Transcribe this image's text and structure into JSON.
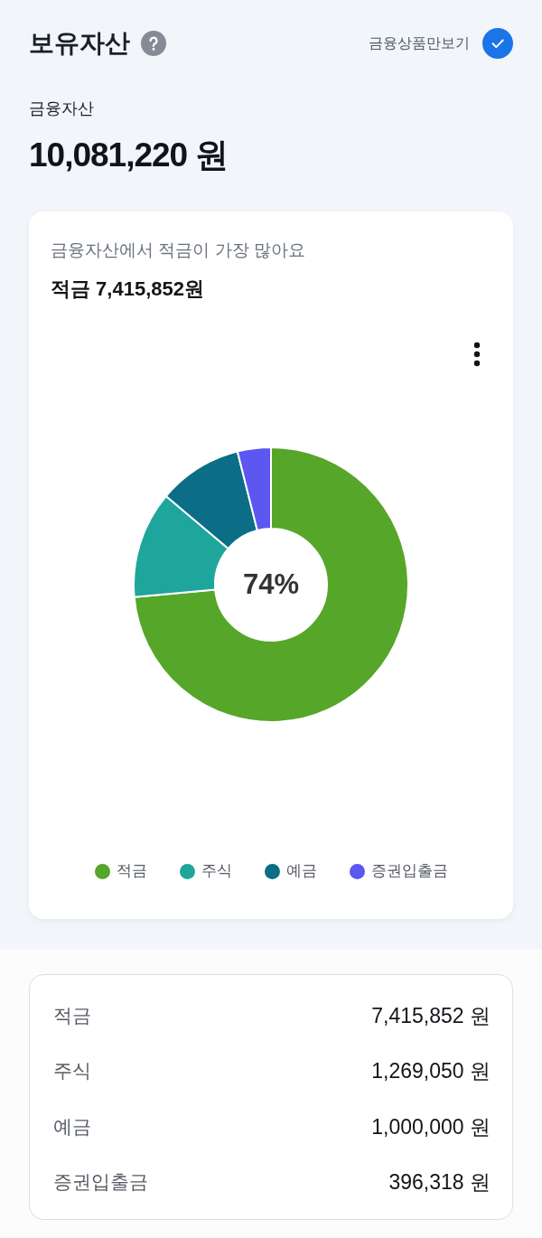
{
  "header": {
    "title": "보유자산",
    "filter": {
      "label": "금융상품만보기",
      "checked": true
    }
  },
  "summary": {
    "label": "금융자산",
    "amount": "10,081,220 원"
  },
  "card": {
    "subtitle": "금융자산에서 적금이 가장 많아요",
    "headline": "적금 7,415,852원",
    "chart_data": {
      "type": "donut",
      "categories": [
        "적금",
        "주식",
        "예금",
        "증권입출금"
      ],
      "values": [
        73.56,
        12.59,
        9.92,
        3.93
      ]
    },
    "center_label": "74%",
    "legend": [
      {
        "color": "#55a629"
      },
      {
        "color": "#1fa69c"
      },
      {
        "color": "#0b6e86"
      },
      {
        "color": "#5b57f0"
      }
    ]
  },
  "breakdown": [
    {
      "label": "적금",
      "amount": "7,415,852 원"
    },
    {
      "label": "주식",
      "amount": "1,269,050 원"
    },
    {
      "label": "예금",
      "amount": "1,000,000 원"
    },
    {
      "label": "증권입출금",
      "amount": "396,318 원"
    }
  ]
}
